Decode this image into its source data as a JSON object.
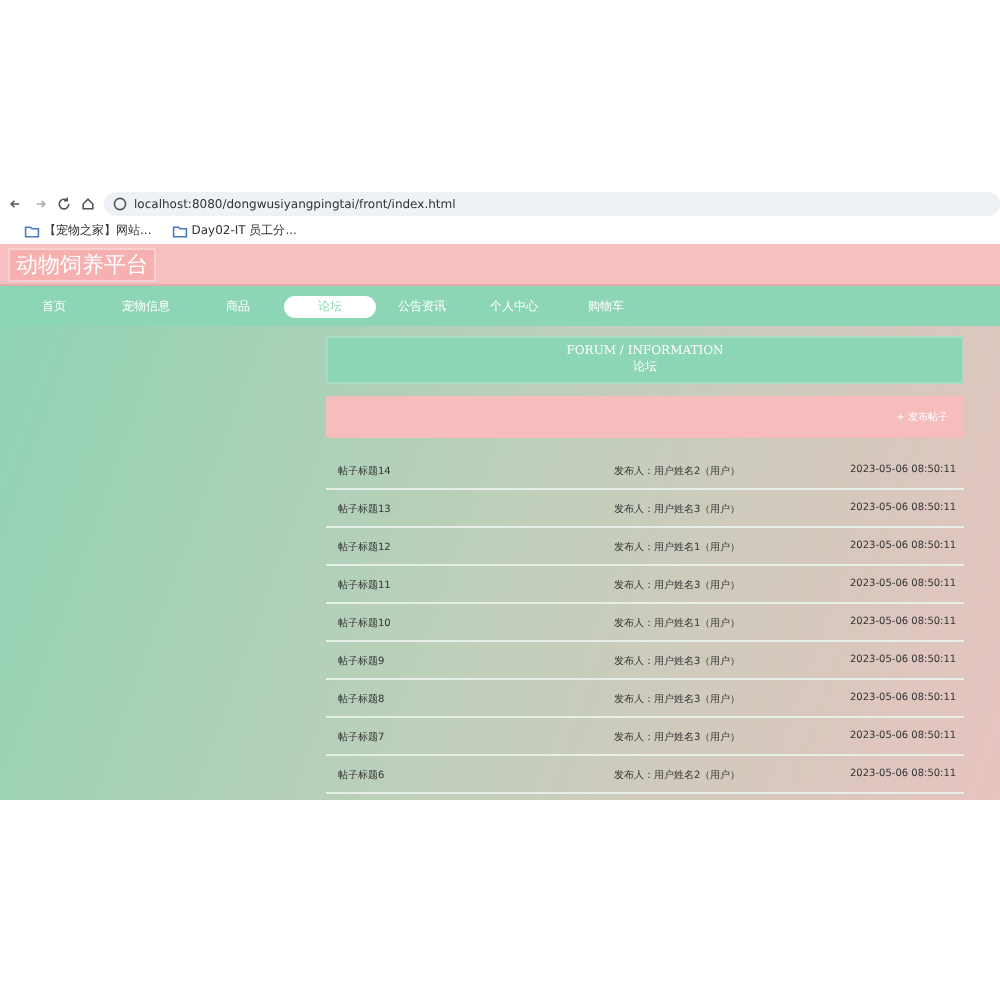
{
  "browser": {
    "url": "localhost:8080/dongwusiyangpingtai/front/index.html",
    "bookmarks": [
      "【宠物之家】网站...",
      "Day02-IT 员工分..."
    ]
  },
  "site_title": "动物饲养平台",
  "nav": [
    {
      "label": "首页",
      "selected": false
    },
    {
      "label": "宠物信息",
      "selected": false
    },
    {
      "label": "商品",
      "selected": false
    },
    {
      "label": "论坛",
      "selected": true
    },
    {
      "label": "公告资讯",
      "selected": false
    },
    {
      "label": "个人中心",
      "selected": false
    },
    {
      "label": "购物车",
      "selected": false
    }
  ],
  "section": {
    "title_en": "FORUM / INFORMATION",
    "title": "论坛"
  },
  "post_button": "+ 发布帖子",
  "posts": [
    {
      "title": "帖子标题14",
      "author": "发布人：用户姓名2（用户）",
      "time": "2023-05-06 08:50:11"
    },
    {
      "title": "帖子标题13",
      "author": "发布人：用户姓名3（用户）",
      "time": "2023-05-06 08:50:11"
    },
    {
      "title": "帖子标题12",
      "author": "发布人：用户姓名1（用户）",
      "time": "2023-05-06 08:50:11"
    },
    {
      "title": "帖子标题11",
      "author": "发布人：用户姓名3（用户）",
      "time": "2023-05-06 08:50:11"
    },
    {
      "title": "帖子标题10",
      "author": "发布人：用户姓名1（用户）",
      "time": "2023-05-06 08:50:11"
    },
    {
      "title": "帖子标题9",
      "author": "发布人：用户姓名3（用户）",
      "time": "2023-05-06 08:50:11"
    },
    {
      "title": "帖子标题8",
      "author": "发布人：用户姓名3（用户）",
      "time": "2023-05-06 08:50:11"
    },
    {
      "title": "帖子标题7",
      "author": "发布人：用户姓名3（用户）",
      "time": "2023-05-06 08:50:11"
    },
    {
      "title": "帖子标题6",
      "author": "发布人：用户姓名2（用户）",
      "time": "2023-05-06 08:50:11"
    }
  ]
}
